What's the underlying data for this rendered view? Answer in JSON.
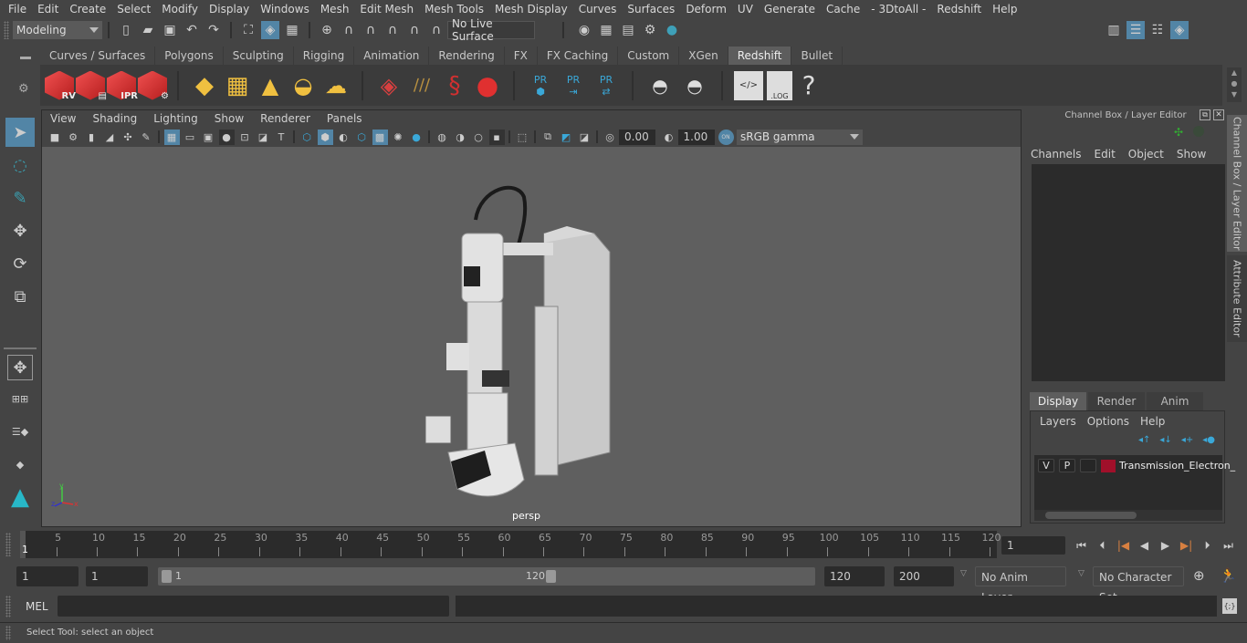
{
  "menubar": [
    "File",
    "Edit",
    "Create",
    "Select",
    "Modify",
    "Display",
    "Windows",
    "Mesh",
    "Edit Mesh",
    "Mesh Tools",
    "Mesh Display",
    "Curves",
    "Surfaces",
    "Deform",
    "UV",
    "Generate",
    "Cache",
    "- 3DtoAll -",
    "Redshift",
    "Help"
  ],
  "statusline": {
    "workspace": "Modeling",
    "live_surface": "No Live Surface"
  },
  "shelf": {
    "tabs": [
      "Curves / Surfaces",
      "Polygons",
      "Sculpting",
      "Rigging",
      "Animation",
      "Rendering",
      "FX",
      "FX Caching",
      "Custom",
      "XGen",
      "Redshift",
      "Bullet"
    ],
    "active_tab": "Redshift",
    "redshift_labels": [
      "RV",
      "",
      "IPR",
      ""
    ],
    "pr_label": "PR",
    "log_label": ".LOG",
    "help_label": "?"
  },
  "viewport": {
    "menu": [
      "View",
      "Shading",
      "Lighting",
      "Show",
      "Renderer",
      "Panels"
    ],
    "exposure": "0.00",
    "gamma": "1.00",
    "colorspace_toggle": "ON",
    "colorspace": "sRGB gamma",
    "camera_label": "persp",
    "axis": {
      "x": "x",
      "y": "y",
      "z": "z"
    },
    "model_name": "Transmission Electron Microscope"
  },
  "channelbox": {
    "title": "Channel Box / Layer Editor",
    "menu": [
      "Channels",
      "Edit",
      "Object",
      "Show"
    ],
    "layer_tabs": [
      "Display",
      "Render",
      "Anim"
    ],
    "active_layer_tab": "Display",
    "layer_menu": [
      "Layers",
      "Options",
      "Help"
    ],
    "layers": [
      {
        "v": "V",
        "p": "P",
        "color": "#a0102a",
        "name": "Transmission_Electron_"
      }
    ]
  },
  "side_tabs": [
    "Channel Box / Layer Editor",
    "Attribute Editor"
  ],
  "timeline": {
    "ticks": [
      5,
      10,
      15,
      20,
      25,
      30,
      35,
      40,
      45,
      50,
      55,
      60,
      65,
      70,
      75,
      80,
      85,
      90,
      95,
      100,
      105,
      110,
      115,
      120
    ],
    "current_frame_marker": "1",
    "current_frame": "1",
    "min": 1,
    "max": 120
  },
  "range": {
    "start_field": "1",
    "playback_start": "1",
    "slider_start": "1",
    "slider_end": "120",
    "playback_end": "120",
    "end_field": "200",
    "anim_layer": "No Anim Layer",
    "character_set": "No Character Set"
  },
  "commandline": {
    "language": "MEL",
    "input": "",
    "output": ""
  },
  "helpline": "Select Tool: select an object"
}
